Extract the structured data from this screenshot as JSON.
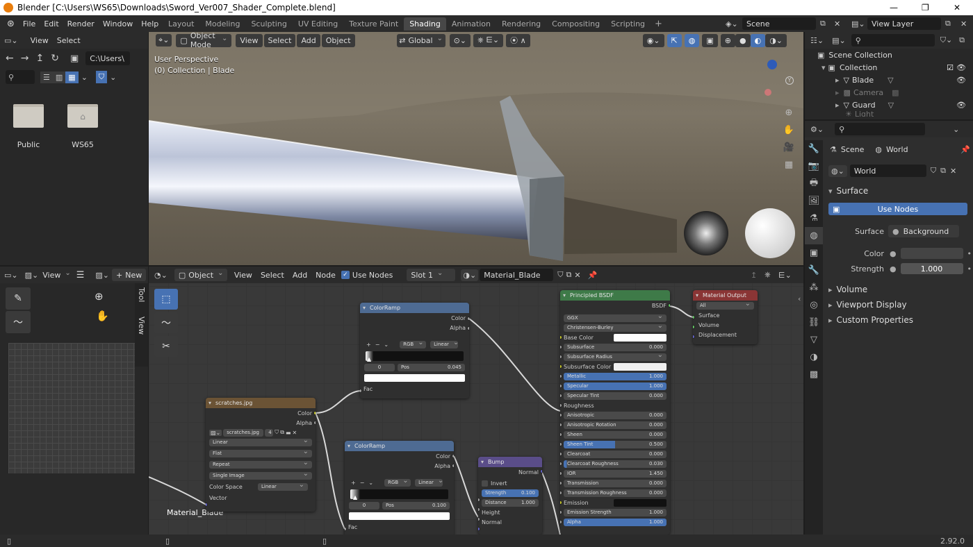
{
  "window": {
    "title": "Blender [C:\\Users\\WS65\\Downloads\\Sword_Ver007_Shader_Complete.blend]",
    "min": "—",
    "max": "❐",
    "close": "✕"
  },
  "menubar": {
    "items": [
      "File",
      "Edit",
      "Render",
      "Window",
      "Help"
    ],
    "workspaces": [
      "Layout",
      "Modeling",
      "Sculpting",
      "UV Editing",
      "Texture Paint",
      "Shading",
      "Animation",
      "Rendering",
      "Compositing",
      "Scripting"
    ],
    "active_workspace": "Shading",
    "add_tab": "+",
    "scene": "Scene",
    "view_layer": "View Layer"
  },
  "filebrowser": {
    "menus": [
      "View",
      "Select"
    ],
    "path": "C:\\Users\\",
    "folders": [
      {
        "name": "Public"
      },
      {
        "name": "WS65"
      }
    ]
  },
  "viewport": {
    "mode": "Object Mode",
    "menus": [
      "View",
      "Select",
      "Add",
      "Object"
    ],
    "orientation": "Global",
    "info_line1": "User Perspective",
    "info_line2": "(0) Collection | Blade"
  },
  "outliner": {
    "root": "Scene Collection",
    "collection": "Collection",
    "items": [
      {
        "name": "Blade",
        "muted": false
      },
      {
        "name": "Camera",
        "muted": true
      },
      {
        "name": "Guard",
        "muted": false
      },
      {
        "name": "Light",
        "muted": true
      }
    ]
  },
  "properties": {
    "breadcrumb_scene": "Scene",
    "breadcrumb_world": "World",
    "world_name": "World",
    "surface_panel": "Surface",
    "use_nodes": "Use Nodes",
    "surface_label": "Surface",
    "surface_value": "Background",
    "color_label": "Color",
    "strength_label": "Strength",
    "strength_value": "1.000",
    "panels": [
      "Volume",
      "Viewport Display",
      "Custom Properties"
    ]
  },
  "image_editor": {
    "view": "View",
    "new": "New",
    "tabs": [
      "Tool",
      "View"
    ]
  },
  "node_editor": {
    "type": "Object",
    "menus": [
      "View",
      "Select",
      "Add",
      "Node"
    ],
    "use_nodes": "Use Nodes",
    "slot": "Slot 1",
    "material": "Material_Blade",
    "frame_label": "Material_Blade"
  },
  "nodes": {
    "colorramp1": {
      "title": "ColorRamp",
      "out_color": "Color",
      "out_alpha": "Alpha",
      "mode": "RGB",
      "interp": "Linear",
      "index": "0",
      "pos_label": "Pos",
      "pos": "0.045",
      "in_fac": "Fac",
      "add": "+",
      "remove": "−"
    },
    "colorramp2": {
      "title": "ColorRamp",
      "out_color": "Color",
      "out_alpha": "Alpha",
      "mode": "RGB",
      "interp": "Linear",
      "index": "0",
      "pos_label": "Pos",
      "pos": "0.100",
      "in_fac": "Fac",
      "add": "+",
      "remove": "−"
    },
    "image": {
      "title": "scratches.jpg",
      "out_color": "Color",
      "out_alpha": "Alpha",
      "file": "scratches.jpg",
      "users": "4",
      "interp": "Linear",
      "proj": "Flat",
      "ext": "Repeat",
      "source": "Single Image",
      "cs_label": "Color Space",
      "cs_value": "Linear",
      "in_vector": "Vector"
    },
    "bump": {
      "title": "Bump",
      "out_normal": "Normal",
      "invert": "Invert",
      "strength_label": "Strength",
      "strength": "0.100",
      "distance_label": "Distance",
      "distance": "1.000",
      "in_height": "Height",
      "in_normal": "Normal"
    },
    "bsdf": {
      "title": "Principled BSDF",
      "out": "BSDF",
      "dist": "GGX",
      "sss": "Christensen-Burley",
      "rows": [
        {
          "label": "Base Color",
          "type": "color",
          "value": ""
        },
        {
          "label": "Subsurface",
          "type": "num",
          "value": "0.000"
        },
        {
          "label": "Subsurface Radius",
          "type": "drop",
          "value": ""
        },
        {
          "label": "Subsurface Color",
          "type": "color2",
          "value": ""
        },
        {
          "label": "Metallic",
          "type": "bar",
          "value": "1.000",
          "fill": 1.0
        },
        {
          "label": "Specular",
          "type": "bar",
          "value": "1.000",
          "fill": 1.0
        },
        {
          "label": "Specular Tint",
          "type": "num",
          "value": "0.000"
        },
        {
          "label": "Roughness",
          "type": "plain",
          "value": ""
        },
        {
          "label": "Anisotropic",
          "type": "num",
          "value": "0.000"
        },
        {
          "label": "Anisotropic Rotation",
          "type": "num",
          "value": "0.000"
        },
        {
          "label": "Sheen",
          "type": "num",
          "value": "0.000"
        },
        {
          "label": "Sheen Tint",
          "type": "bar",
          "value": "0.500",
          "fill": 0.5
        },
        {
          "label": "Clearcoat",
          "type": "num",
          "value": "0.000"
        },
        {
          "label": "Clearcoat Roughness",
          "type": "bar",
          "value": "0.030",
          "fill": 0.03
        },
        {
          "label": "IOR",
          "type": "num",
          "value": "1.450"
        },
        {
          "label": "Transmission",
          "type": "num",
          "value": "0.000"
        },
        {
          "label": "Transmission Roughness",
          "type": "num",
          "value": "0.000"
        },
        {
          "label": "Emission",
          "type": "dark",
          "value": ""
        },
        {
          "label": "Emission Strength",
          "type": "num",
          "value": "1.000"
        },
        {
          "label": "Alpha",
          "type": "bar",
          "value": "1.000",
          "fill": 1.0
        }
      ]
    },
    "output": {
      "title": "Material Output",
      "target": "All",
      "in_surface": "Surface",
      "in_volume": "Volume",
      "in_disp": "Displacement"
    }
  },
  "statusbar": {
    "version": "2.92.0"
  },
  "colors": {
    "accent": "#4772b3",
    "header": "#2b2b2b",
    "panel": "#303030",
    "node_grid": "#393939"
  }
}
